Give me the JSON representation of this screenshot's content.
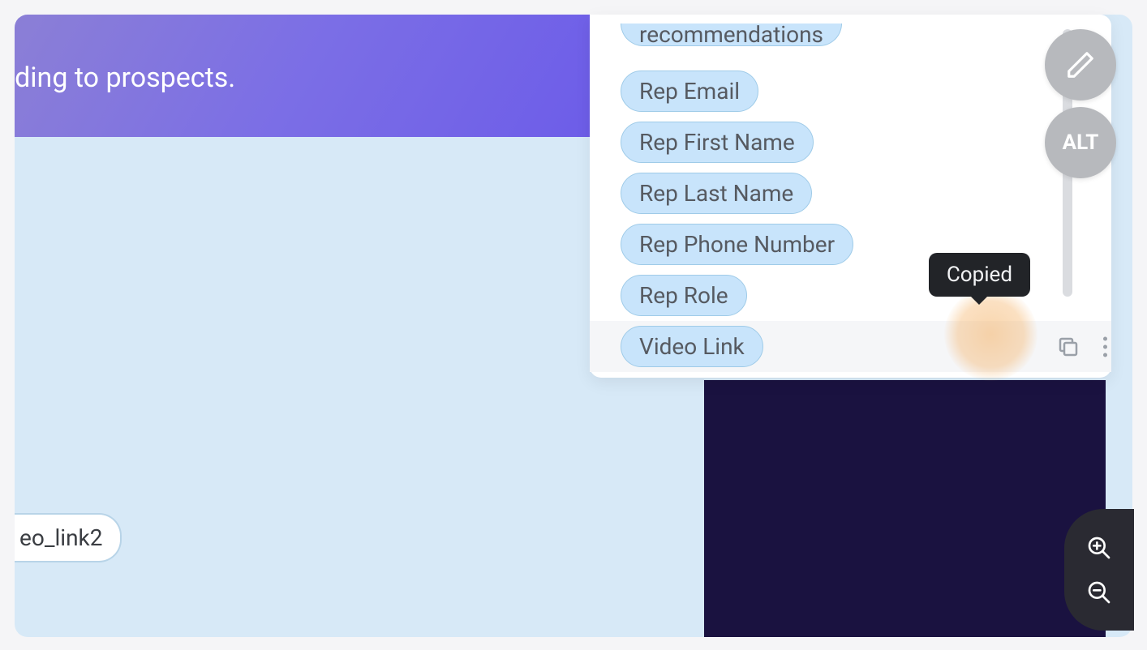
{
  "banner": {
    "text": "oposals you're sending to prospects."
  },
  "canvas_tag": {
    "label": "eo_link2"
  },
  "variables_panel": {
    "chips": [
      "recommendations",
      "Rep Email",
      "Rep First Name",
      "Rep Last Name",
      "Rep Phone Number",
      "Rep Role",
      "Video Link"
    ],
    "selected_index": 6
  },
  "tooltip": {
    "label": "Copied"
  },
  "floating_buttons": {
    "alt_label": "ALT"
  },
  "icons": {
    "edit": "pencil-icon",
    "copy": "copy-icon",
    "more": "more-vertical-icon",
    "zoom_in": "zoom-in-icon",
    "zoom_out": "zoom-out-icon"
  },
  "colors": {
    "chip_bg": "#c8e4fb",
    "chip_border": "#9fcbe8",
    "highlight": "#f5b266",
    "tooltip_bg": "#222428"
  }
}
